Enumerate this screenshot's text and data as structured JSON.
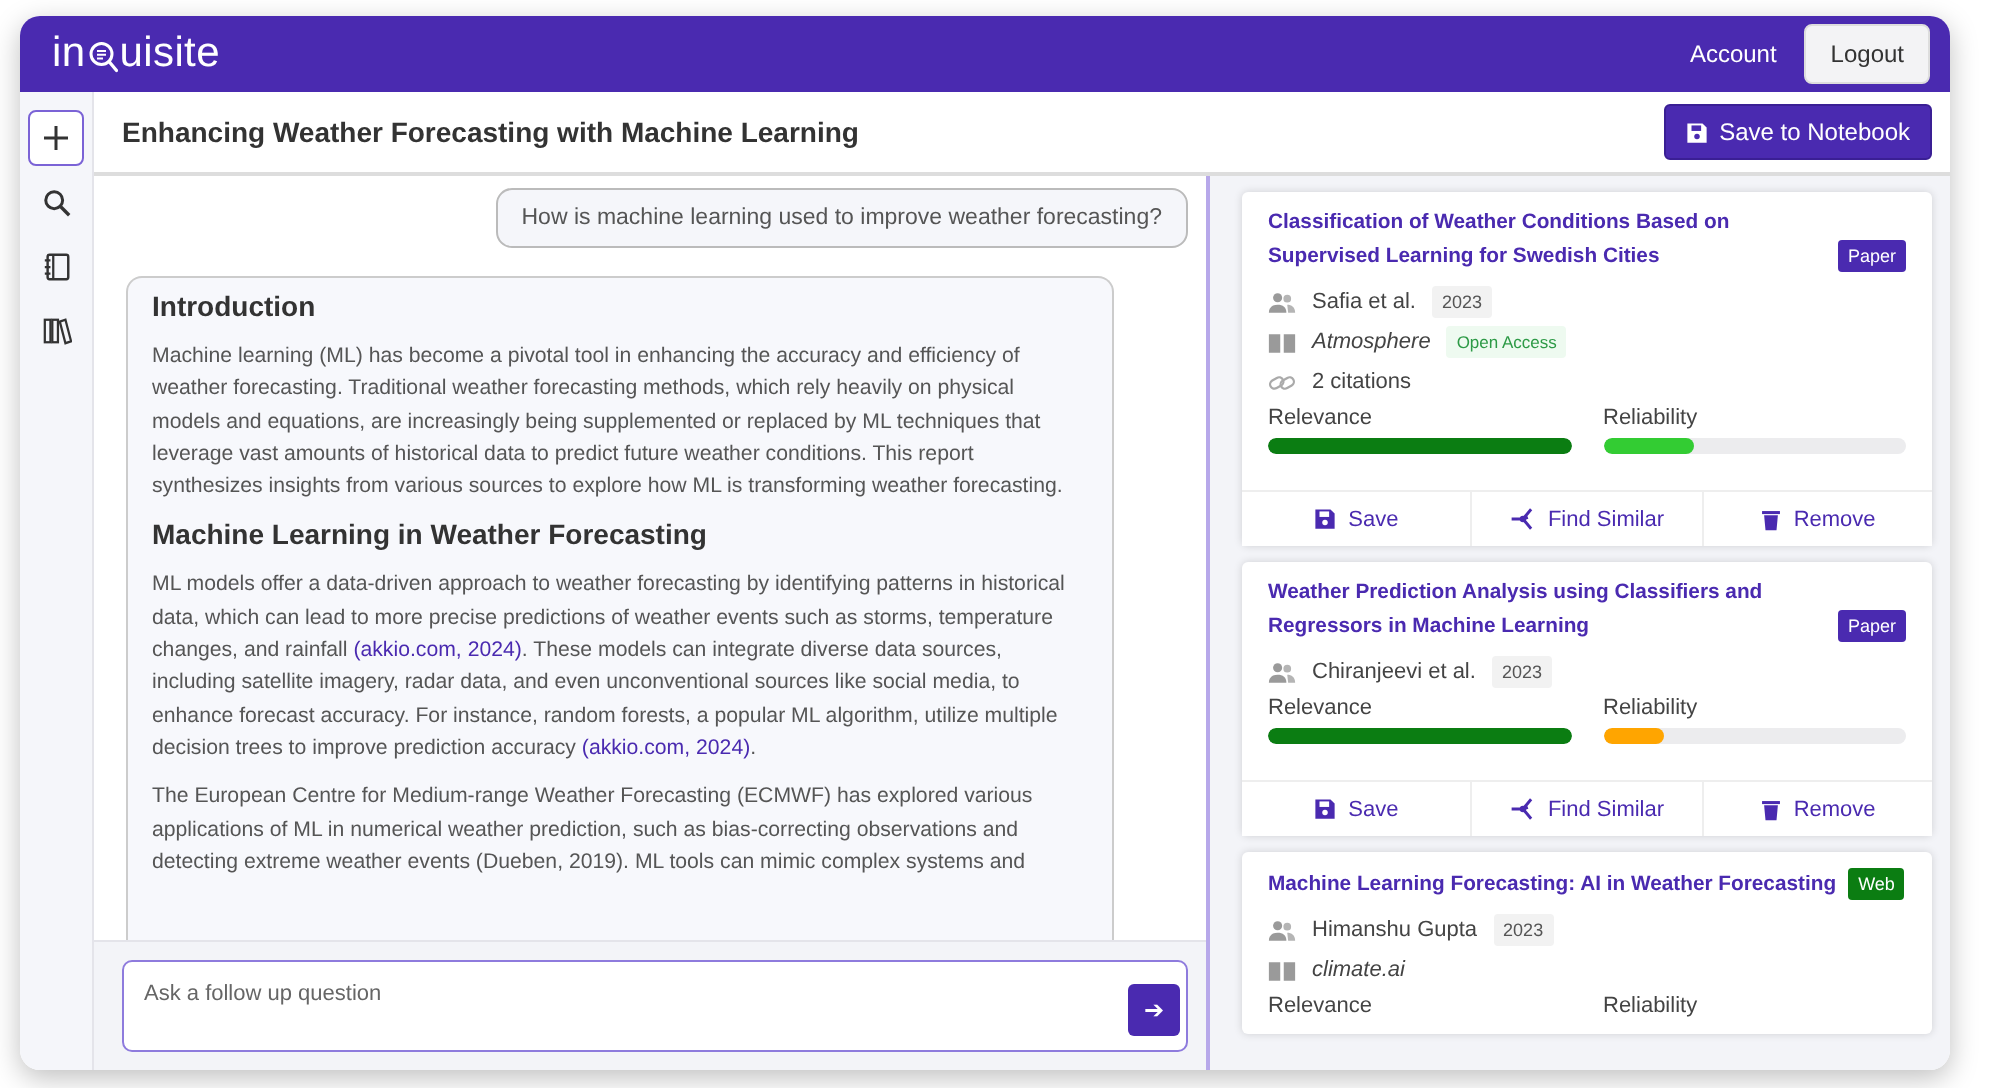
{
  "header": {
    "logo": {
      "before": "in",
      "after": "uisite"
    },
    "links": [
      {
        "label": "Account",
        "kind": "link"
      },
      {
        "label": "Logout",
        "kind": "button"
      }
    ]
  },
  "sidebar": {
    "items": [
      {
        "selected": true
      },
      {
        "selected": false
      },
      {
        "selected": false
      },
      {
        "selected": false
      }
    ]
  },
  "title": "Enhancing Weather Forecasting with Machine Learning",
  "save_button": "Save to Notebook",
  "question": "How is machine learning used to improve weather forecasting?",
  "report": [
    {
      "kind": "heading",
      "parts": [
        {
          "kind": "text",
          "text": "Introduction"
        }
      ]
    },
    {
      "kind": "paragraph",
      "parts": [
        {
          "kind": "text",
          "text": "Machine learning (ML) has become a pivotal tool in enhancing the accuracy and efficiency of weather forecasting. Traditional weather forecasting methods, which rely heavily on physical models and equations, are increasingly being supplemented or replaced by ML techniques that leverage vast amounts of historical data to predict future weather conditions. This report synthesizes insights from various sources to explore how ML is transforming weather forecasting."
        }
      ]
    },
    {
      "kind": "heading",
      "parts": [
        {
          "kind": "text",
          "text": "Machine Learning in Weather Forecasting"
        }
      ]
    },
    {
      "kind": "paragraph",
      "parts": [
        {
          "kind": "text",
          "text": "ML models offer a data-driven approach to weather forecasting by identifying patterns in historical data, which can lead to more precise predictions of weather events such as storms, temperature changes, and rainfall "
        },
        {
          "kind": "link",
          "text": "(akkio.com, 2024)"
        },
        {
          "kind": "text",
          "text": ". These models can integrate diverse data sources, including satellite imagery, radar data, and even unconventional sources like social media, to enhance forecast accuracy. For instance, random forests, a popular ML algorithm, utilize multiple decision trees to improve prediction accuracy "
        },
        {
          "kind": "link",
          "text": "(akkio.com, 2024)"
        },
        {
          "kind": "text",
          "text": "."
        }
      ]
    },
    {
      "kind": "paragraph",
      "parts": [
        {
          "kind": "text",
          "text": "The European Centre for Medium-range Weather Forecasting (ECMWF) has explored various applications of ML in numerical weather prediction, such as bias-correcting observations and detecting extreme weather events (Dueben, 2019). ML tools can mimic complex systems and"
        }
      ]
    }
  ],
  "followup": {
    "placeholder": "Ask a follow up question",
    "send": "➔"
  },
  "sources": [
    {
      "title": "Classification of Weather Conditions Based on Supervised Learning for Swedish Cities",
      "tag": {
        "label": "Paper",
        "color": "#4a2ab0"
      },
      "authors": "Safia et al.",
      "year": "2023",
      "journal": "Atmosphere",
      "badge": "Open Access",
      "citations": "2 citations",
      "metrics": [
        {
          "label": "Relevance",
          "level": 1.0,
          "color": "#0b7d12"
        },
        {
          "label": "Reliability",
          "level": 0.3,
          "color": "#33cc33"
        }
      ],
      "actions": [
        {
          "label": "Save"
        },
        {
          "label": "Find Similar"
        },
        {
          "label": "Remove"
        }
      ]
    },
    {
      "title": "Weather Prediction Analysis using Classifiers and Regressors in Machine Learning",
      "tag": {
        "label": "Paper",
        "color": "#4a2ab0"
      },
      "authors": "Chiranjeevi et al.",
      "year": "2023",
      "metrics": [
        {
          "label": "Relevance",
          "level": 1.0,
          "color": "#0b7d12"
        },
        {
          "label": "Reliability",
          "level": 0.2,
          "color": "#ffa500"
        }
      ],
      "actions": [
        {
          "label": "Save"
        },
        {
          "label": "Find Similar"
        },
        {
          "label": "Remove"
        }
      ]
    },
    {
      "title": "Machine Learning Forecasting: AI in Weather Forecasting",
      "tag": {
        "label": "Web",
        "color": "#0b7d12"
      },
      "authors": "Himanshu Gupta",
      "year": "2023",
      "journal": "climate.ai",
      "metrics": [
        {
          "label": "Relevance"
        },
        {
          "label": "Reliability"
        }
      ]
    }
  ]
}
